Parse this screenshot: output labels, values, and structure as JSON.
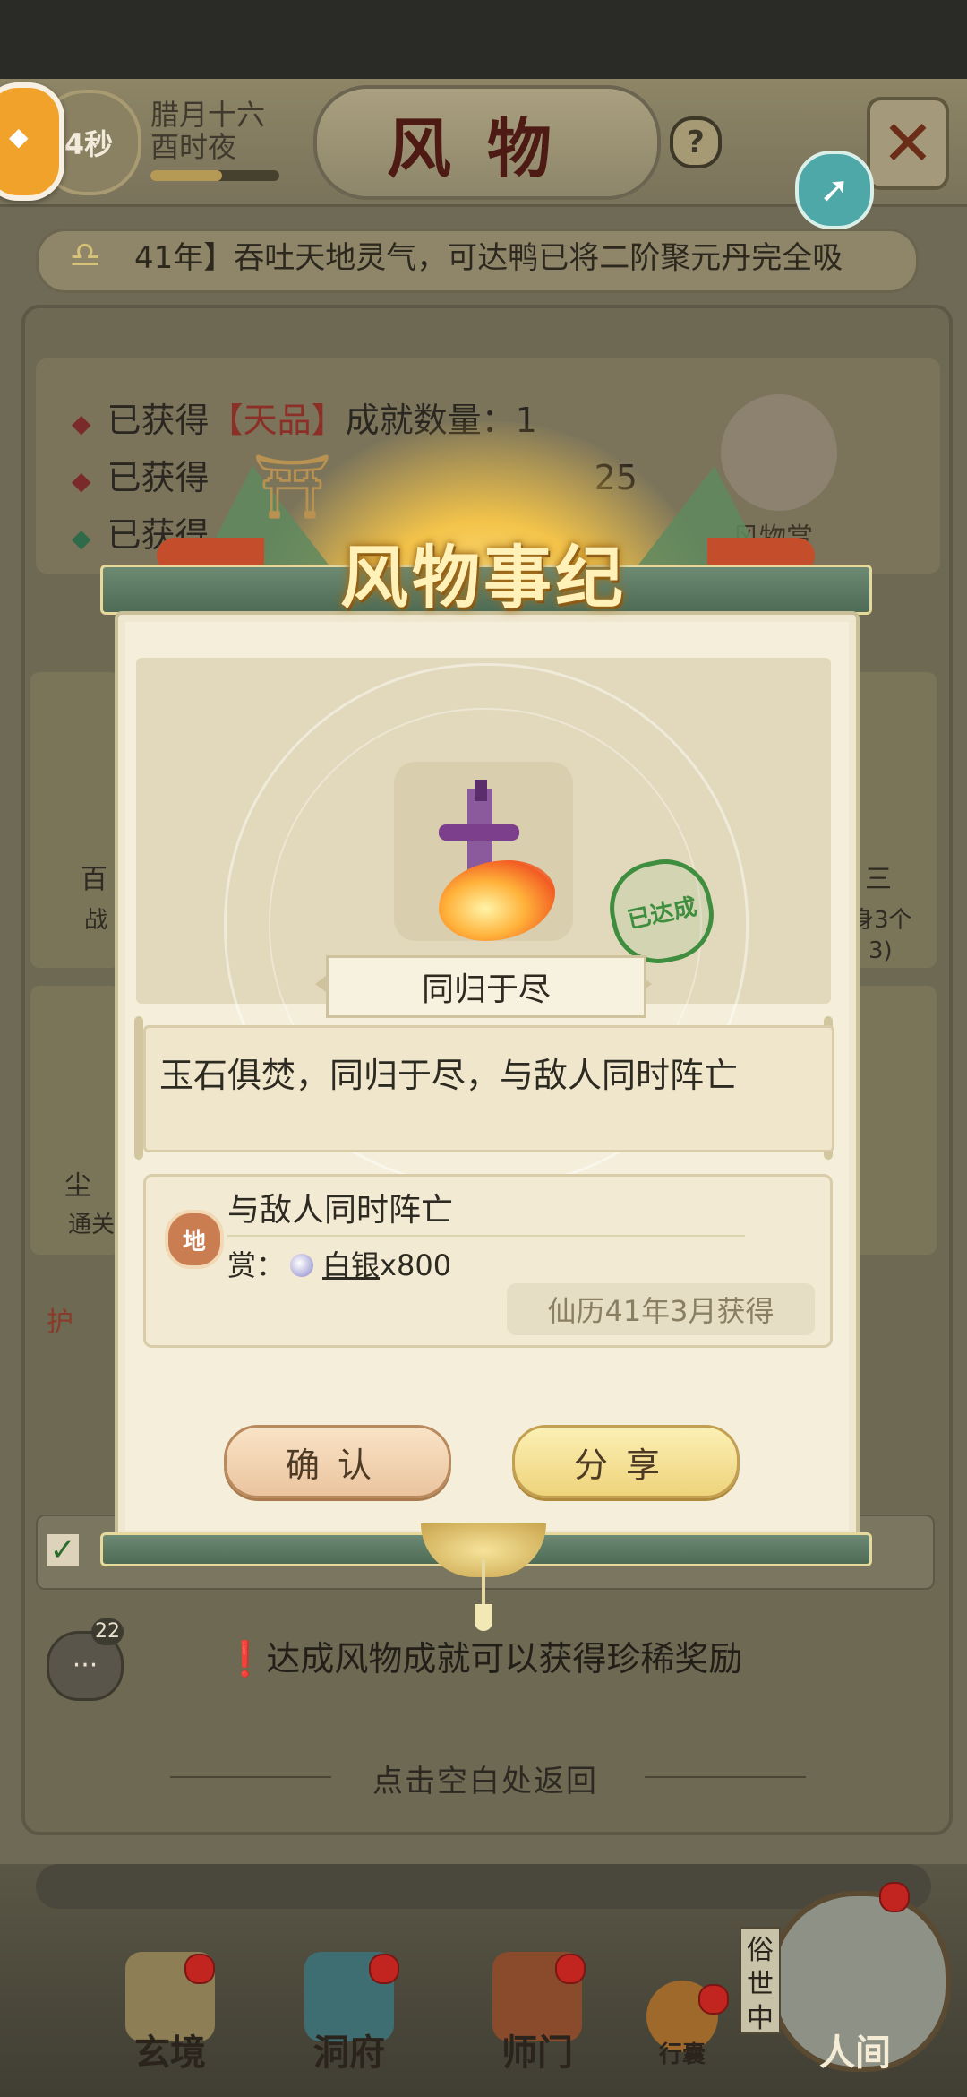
{
  "header": {
    "timer": "4秒",
    "date_line1": "腊月十六",
    "date_line2": "酉时夜",
    "title": "风物",
    "help_symbol": "?"
  },
  "notice": {
    "text": "41年】吞吐天地灵气，可达鸭已将二阶聚元丹完全吸"
  },
  "achievements": {
    "line1_prefix": "已获得",
    "line1_tier": "【天品】",
    "line1_suffix": "成就数量：1",
    "line2_prefix": "已获得",
    "line2_value": "25",
    "line3_prefix": "已获得",
    "mascot_label": "风物赏"
  },
  "background_cards": {
    "left_top": "百",
    "left_top_sub": "战",
    "right_top": "三",
    "right_top_sub": "身3个",
    "right_top_count": "3)",
    "left_bottom": "尘",
    "left_bottom_sub": "通关",
    "left_bottom_2": "护"
  },
  "modal": {
    "title": "风物事纪",
    "achievement_name": "同归于尽",
    "stamp_text": "已达成",
    "description": "玉石俱焚，同归于尽，与敌人同时阵亡",
    "tier_badge": "地",
    "reward_title": "与敌人同时阵亡",
    "reward_label": "赏：",
    "reward_item": "白银",
    "reward_qty": "x800",
    "obtained_date": "仙历41年3月获得",
    "confirm_label": "确认",
    "share_label": "分享"
  },
  "footer": {
    "chat_count": "22",
    "hint": "达成风物成就可以获得珍稀奖励",
    "back_hint": "点击空白处返回"
  },
  "nav": {
    "items": [
      "玄境",
      "洞府",
      "师门",
      "行囊",
      "人间"
    ],
    "renjian_tag": "俗世中"
  },
  "colors": {
    "accent_gold": "#f4c44a",
    "stamp_green": "#3f8e3f",
    "badge_red": "#c2251f"
  }
}
